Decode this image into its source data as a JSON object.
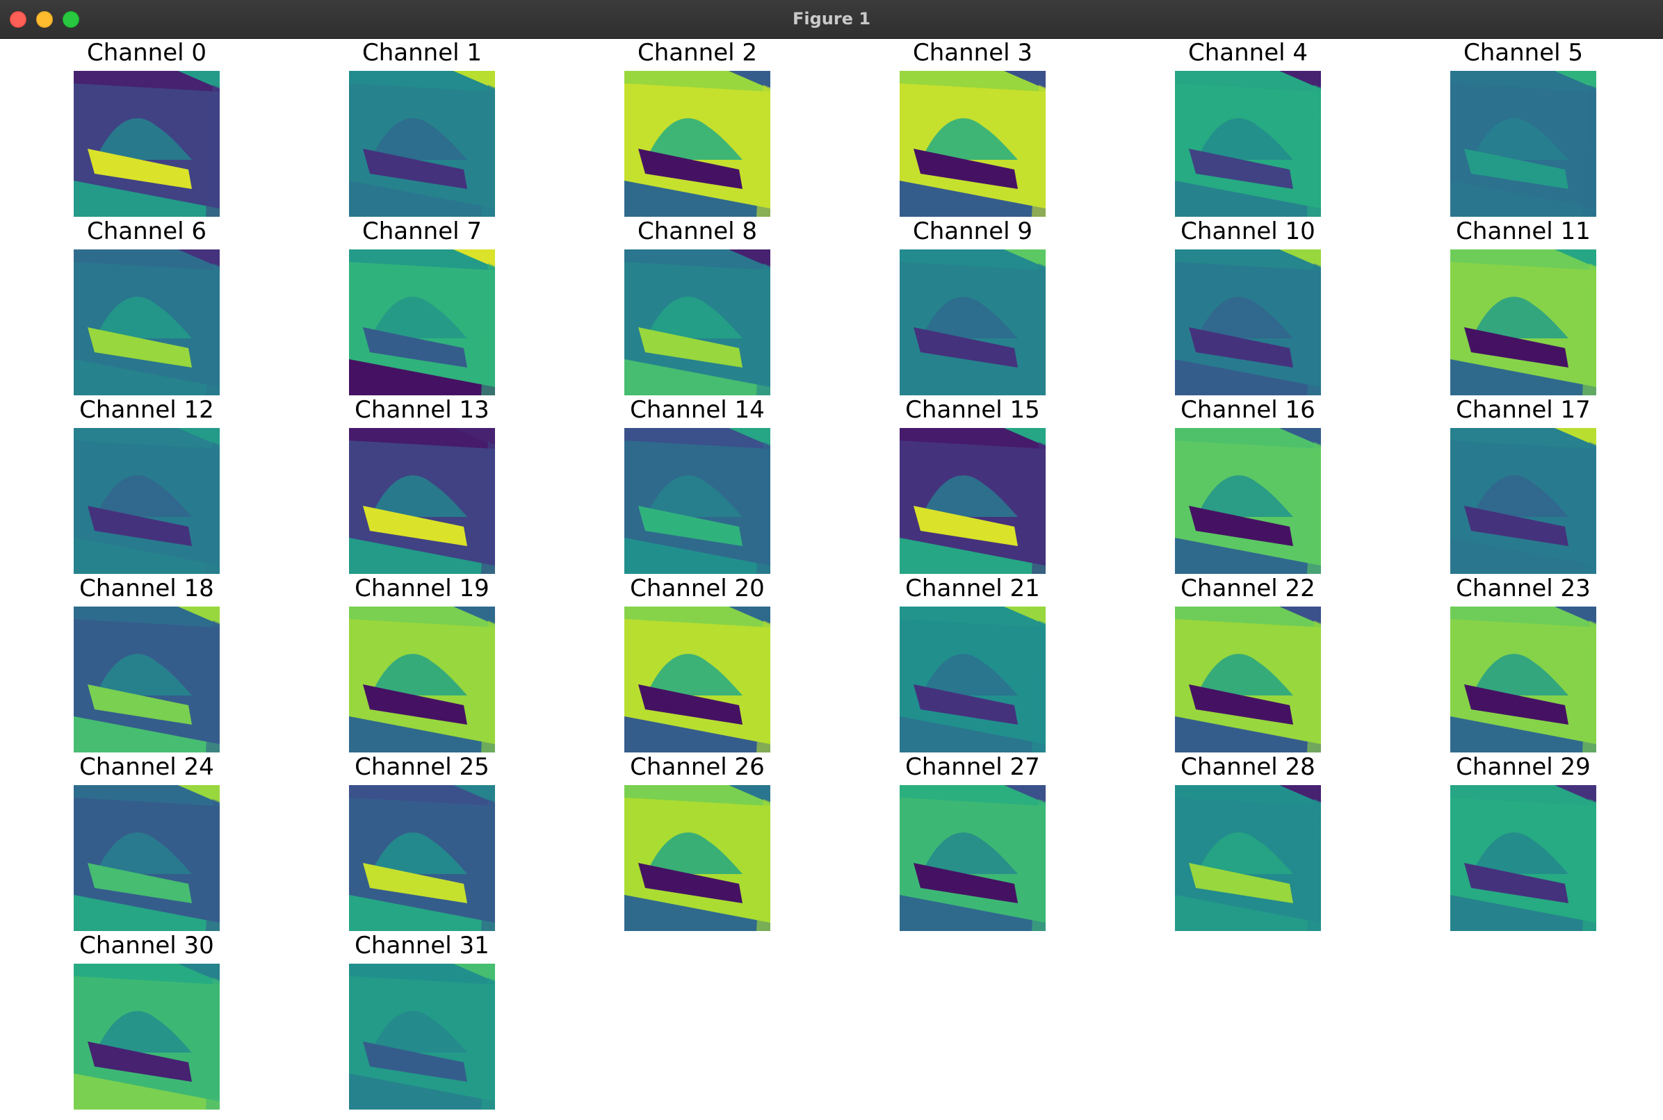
{
  "window": {
    "title": "Figure 1",
    "buttons": {
      "close": "close",
      "minimize": "minimize",
      "maximize": "maximize"
    }
  },
  "colors": {
    "titlebar": "#333333",
    "close": "#fe5f57",
    "minimize": "#febc2e",
    "maximize": "#28c840"
  },
  "colormap": "viridis",
  "grid": {
    "columns": 6
  },
  "panels": [
    {
      "title": "Channel 0",
      "bg": 0.2,
      "tilt": 0.1,
      "fg": 0.95,
      "band": 0.55,
      "corner": 0.55
    },
    {
      "title": "Channel 1",
      "bg": 0.45,
      "tilt": 0.48,
      "fg": 0.15,
      "band": 0.4,
      "corner": 0.9
    },
    {
      "title": "Channel 2",
      "bg": 0.92,
      "tilt": 0.85,
      "fg": 0.05,
      "band": 0.35,
      "corner": 0.3
    },
    {
      "title": "Channel 3",
      "bg": 0.92,
      "tilt": 0.85,
      "fg": 0.05,
      "band": 0.3,
      "corner": 0.25
    },
    {
      "title": "Channel 4",
      "bg": 0.62,
      "tilt": 0.6,
      "fg": 0.2,
      "band": 0.45,
      "corner": 0.1
    },
    {
      "title": "Channel 5",
      "bg": 0.38,
      "tilt": 0.4,
      "fg": 0.55,
      "band": 0.4,
      "corner": 0.65
    },
    {
      "title": "Channel 6",
      "bg": 0.4,
      "tilt": 0.36,
      "fg": 0.85,
      "band": 0.45,
      "corner": 0.15
    },
    {
      "title": "Channel 7",
      "bg": 0.65,
      "tilt": 0.55,
      "fg": 0.3,
      "band": 0.05,
      "corner": 0.95
    },
    {
      "title": "Channel 8",
      "bg": 0.45,
      "tilt": 0.4,
      "fg": 0.85,
      "band": 0.7,
      "corner": 0.1
    },
    {
      "title": "Channel 9",
      "bg": 0.45,
      "tilt": 0.48,
      "fg": 0.15,
      "band": 0.45,
      "corner": 0.75
    },
    {
      "title": "Channel 10",
      "bg": 0.42,
      "tilt": 0.46,
      "fg": 0.15,
      "band": 0.3,
      "corner": 0.85
    },
    {
      "title": "Channel 11",
      "bg": 0.82,
      "tilt": 0.78,
      "fg": 0.05,
      "band": 0.35,
      "corner": 0.6
    },
    {
      "title": "Channel 12",
      "bg": 0.42,
      "tilt": 0.44,
      "fg": 0.15,
      "band": 0.45,
      "corner": 0.55
    },
    {
      "title": "Channel 13",
      "bg": 0.2,
      "tilt": 0.08,
      "fg": 0.95,
      "band": 0.55,
      "corner": 0.1
    },
    {
      "title": "Channel 14",
      "bg": 0.35,
      "tilt": 0.25,
      "fg": 0.65,
      "band": 0.5,
      "corner": 0.6
    },
    {
      "title": "Channel 15",
      "bg": 0.15,
      "tilt": 0.08,
      "fg": 0.95,
      "band": 0.6,
      "corner": 0.6
    },
    {
      "title": "Channel 16",
      "bg": 0.75,
      "tilt": 0.72,
      "fg": 0.05,
      "band": 0.35,
      "corner": 0.3
    },
    {
      "title": "Channel 17",
      "bg": 0.42,
      "tilt": 0.44,
      "fg": 0.15,
      "band": 0.4,
      "corner": 0.9
    },
    {
      "title": "Channel 18",
      "bg": 0.3,
      "tilt": 0.36,
      "fg": 0.8,
      "band": 0.7,
      "corner": 0.85
    },
    {
      "title": "Channel 19",
      "bg": 0.85,
      "tilt": 0.8,
      "fg": 0.05,
      "band": 0.35,
      "corner": 0.35
    },
    {
      "title": "Channel 20",
      "bg": 0.9,
      "tilt": 0.82,
      "fg": 0.05,
      "band": 0.3,
      "corner": 0.35
    },
    {
      "title": "Channel 21",
      "bg": 0.5,
      "tilt": 0.52,
      "fg": 0.15,
      "band": 0.4,
      "corner": 0.85
    },
    {
      "title": "Channel 22",
      "bg": 0.85,
      "tilt": 0.78,
      "fg": 0.05,
      "band": 0.3,
      "corner": 0.25
    },
    {
      "title": "Channel 23",
      "bg": 0.82,
      "tilt": 0.78,
      "fg": 0.05,
      "band": 0.35,
      "corner": 0.3
    },
    {
      "title": "Channel 24",
      "bg": 0.3,
      "tilt": 0.36,
      "fg": 0.7,
      "band": 0.6,
      "corner": 0.85
    },
    {
      "title": "Channel 25",
      "bg": 0.3,
      "tilt": 0.25,
      "fg": 0.92,
      "band": 0.6,
      "corner": 0.45
    },
    {
      "title": "Channel 26",
      "bg": 0.88,
      "tilt": 0.8,
      "fg": 0.05,
      "band": 0.35,
      "corner": 0.4
    },
    {
      "title": "Channel 27",
      "bg": 0.68,
      "tilt": 0.64,
      "fg": 0.05,
      "band": 0.35,
      "corner": 0.25
    },
    {
      "title": "Channel 28",
      "bg": 0.48,
      "tilt": 0.5,
      "fg": 0.85,
      "band": 0.55,
      "corner": 0.1
    },
    {
      "title": "Channel 29",
      "bg": 0.62,
      "tilt": 0.6,
      "fg": 0.15,
      "band": 0.45,
      "corner": 0.15
    },
    {
      "title": "Channel 30",
      "bg": 0.68,
      "tilt": 0.62,
      "fg": 0.1,
      "band": 0.8,
      "corner": 0.45
    },
    {
      "title": "Channel 31",
      "bg": 0.55,
      "tilt": 0.5,
      "fg": 0.3,
      "band": 0.45,
      "corner": 0.7
    }
  ]
}
